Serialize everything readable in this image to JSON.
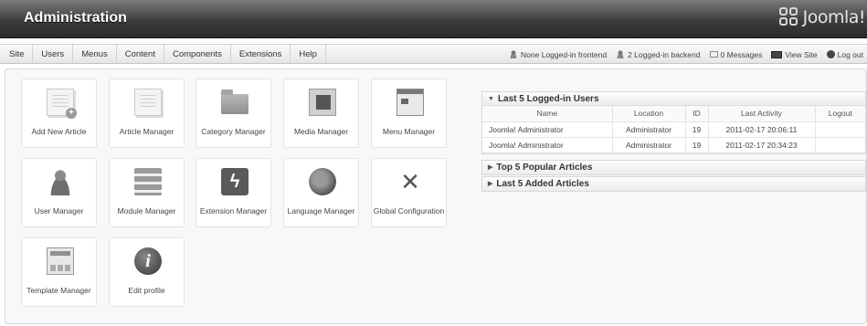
{
  "header": {
    "title": "Administration",
    "logo_text": "Joomla!"
  },
  "menu": [
    "Site",
    "Users",
    "Menus",
    "Content",
    "Components",
    "Extensions",
    "Help"
  ],
  "status": {
    "frontend": "None Logged-in frontend",
    "backend": "2 Logged-in backend",
    "messages": "0 Messages",
    "view_site": "View Site",
    "logout": "Log out"
  },
  "icons": [
    {
      "label": "Add New Article",
      "icon": "add-article-icon"
    },
    {
      "label": "Article Manager",
      "icon": "article-icon"
    },
    {
      "label": "Category Manager",
      "icon": "folder-icon"
    },
    {
      "label": "Media Manager",
      "icon": "media-icon"
    },
    {
      "label": "Menu Manager",
      "icon": "menu-icon"
    },
    {
      "label": "User Manager",
      "icon": "user-icon"
    },
    {
      "label": "Module Manager",
      "icon": "module-icon"
    },
    {
      "label": "Extension Manager",
      "icon": "extension-icon"
    },
    {
      "label": "Language Manager",
      "icon": "globe-icon"
    },
    {
      "label": "Global Configuration",
      "icon": "tools-icon"
    },
    {
      "label": "Template Manager",
      "icon": "template-icon"
    },
    {
      "label": "Edit profile",
      "icon": "info-icon"
    }
  ],
  "modules": {
    "logged_in": {
      "title": "Last 5 Logged-in Users",
      "columns": [
        "Name",
        "Location",
        "ID",
        "Last Activity",
        "Logout"
      ],
      "rows": [
        {
          "name": "Joomla! Administrator",
          "location": "Administrator",
          "id": "19",
          "last_activity": "2011-02-17 20:06:11",
          "logout": ""
        },
        {
          "name": "Joomla! Administrator",
          "location": "Administrator",
          "id": "19",
          "last_activity": "2011-02-17 20:34:23",
          "logout": ""
        }
      ]
    },
    "popular": {
      "title": "Top 5 Popular Articles"
    },
    "added": {
      "title": "Last 5 Added Articles"
    }
  }
}
